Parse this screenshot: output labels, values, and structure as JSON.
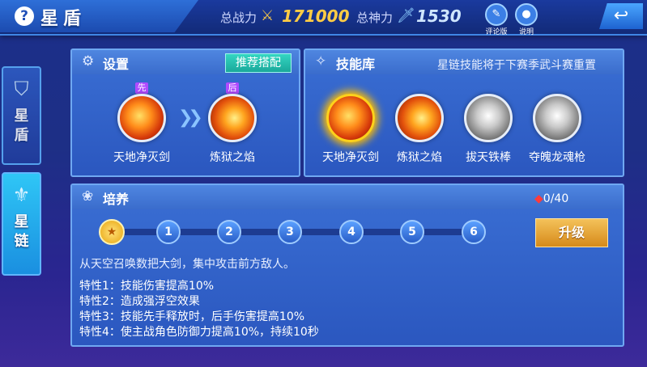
{
  "header": {
    "help_icon": "?",
    "title": "星盾",
    "power_label": "总战力",
    "power_value": "171000",
    "spirit_label": "总神力",
    "spirit_value": "1530",
    "review_label": "评论版",
    "info_label": "说明",
    "back_icon": "back-arrow-icon"
  },
  "sidebar": {
    "items": [
      {
        "label": "星\n盾",
        "icon": "shield-star-icon"
      },
      {
        "label": "星\n链",
        "icon": "chain-icon"
      }
    ]
  },
  "setup": {
    "title": "设置",
    "recommend_label": "推荐搭配",
    "first_tag": "先",
    "second_tag": "后",
    "skills": [
      "天地净灭剑",
      "炼狱之焰"
    ]
  },
  "library": {
    "title": "技能库",
    "note": "星链技能将于下赛季武斗赛重置",
    "skills": [
      "天地净灭剑",
      "炼狱之焰",
      "拔天铁棒",
      "夺魄龙魂枪"
    ]
  },
  "cultivate": {
    "title": "培养",
    "gems": "0/40",
    "nodes": [
      "★",
      "1",
      "2",
      "3",
      "4",
      "5",
      "6"
    ],
    "upgrade_label": "升级",
    "description": "从天空召唤数把大剑，集中攻击前方敌人。",
    "traits": [
      "特性1：技能伤害提高10%",
      "特性2：造成强浮空效果",
      "特性3：技能先手释放时，后手伤害提高10%",
      "特性4：使主战角色防御力提高10%，持续10秒"
    ]
  },
  "colors": {
    "accent": "#3f86e6",
    "gold": "#f0c24a",
    "teal": "#34d6c2"
  }
}
